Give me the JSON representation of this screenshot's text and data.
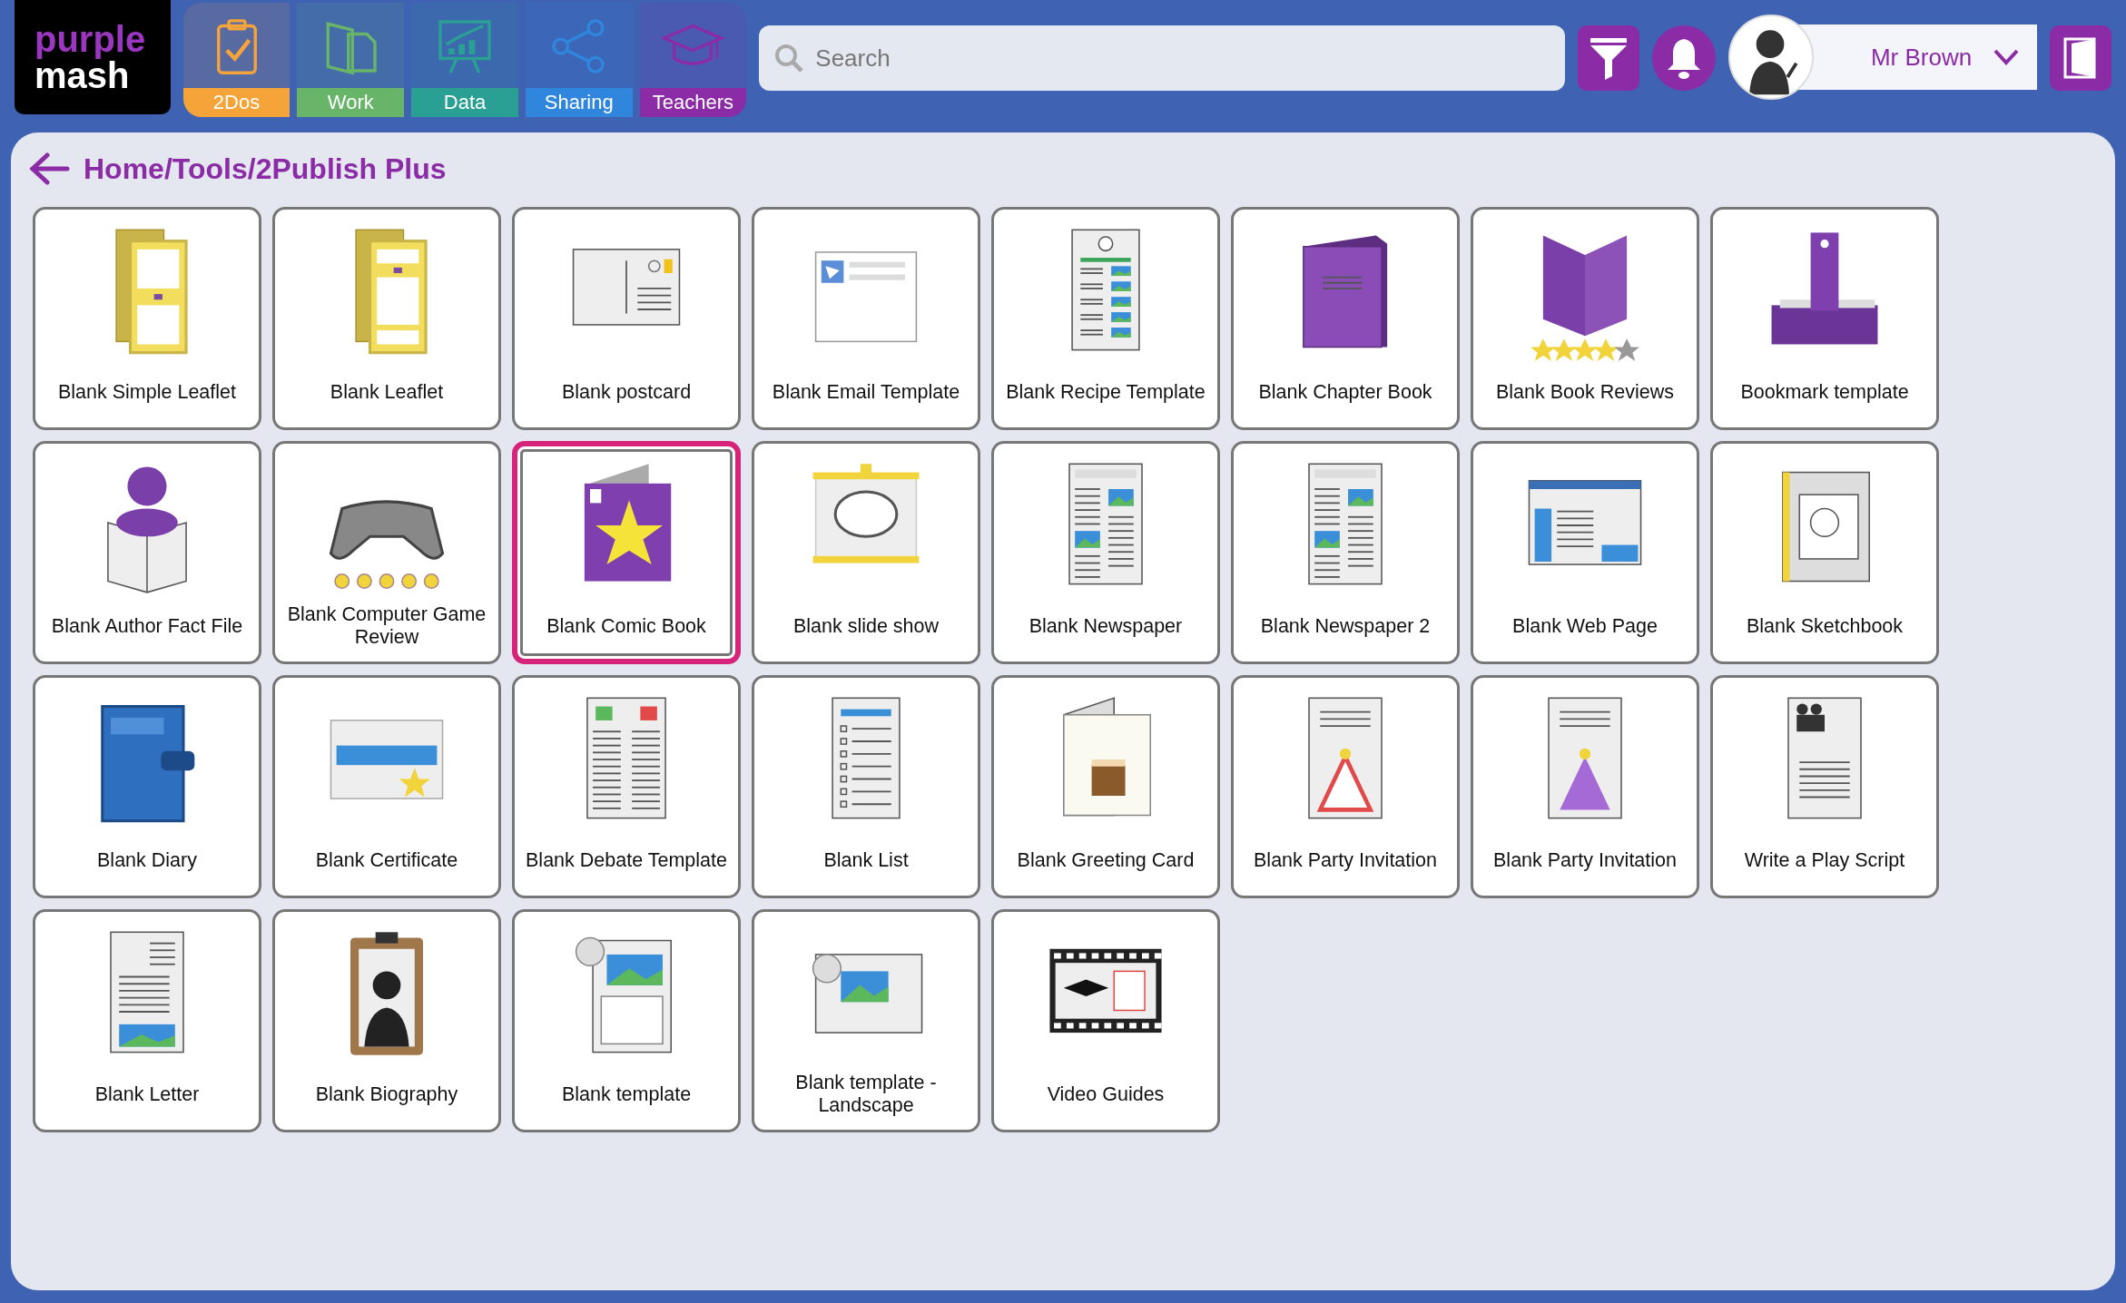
{
  "logo": {
    "line1": "purple",
    "line2": "mash"
  },
  "nav": [
    {
      "label": "2Dos",
      "kind": "todo",
      "color": "#f5a43a"
    },
    {
      "label": "Work",
      "kind": "work",
      "color": "#68b468"
    },
    {
      "label": "Data",
      "kind": "data",
      "color": "#2a9f94"
    },
    {
      "label": "Sharing",
      "kind": "sharing",
      "color": "#2f86dc"
    },
    {
      "label": "Teachers",
      "kind": "teachers",
      "color": "#8b2ba6"
    }
  ],
  "search": {
    "placeholder": "Search"
  },
  "user": {
    "name": "Mr Brown"
  },
  "breadcrumb": "Home/Tools/2Publish Plus",
  "tiles": [
    {
      "label": "Blank Simple Leaflet",
      "kind": "leaflet",
      "selected": false
    },
    {
      "label": "Blank Leaflet",
      "kind": "leaflet2",
      "selected": false
    },
    {
      "label": "Blank postcard",
      "kind": "postcard",
      "selected": false
    },
    {
      "label": "Blank Email Template",
      "kind": "email",
      "selected": false
    },
    {
      "label": "Blank Recipe Template",
      "kind": "recipe",
      "selected": false
    },
    {
      "label": "Blank Chapter Book",
      "kind": "book",
      "selected": false
    },
    {
      "label": "Blank Book Reviews",
      "kind": "reviews",
      "selected": false
    },
    {
      "label": "Bookmark template",
      "kind": "bookmark",
      "selected": false
    },
    {
      "label": "Blank Author Fact File",
      "kind": "author",
      "selected": false
    },
    {
      "label": "Blank Computer Game Review",
      "kind": "game",
      "selected": false
    },
    {
      "label": "Blank Comic Book",
      "kind": "comic",
      "selected": true
    },
    {
      "label": "Blank slide show",
      "kind": "slideshow",
      "selected": false
    },
    {
      "label": "Blank Newspaper",
      "kind": "newspaper",
      "selected": false
    },
    {
      "label": "Blank Newspaper 2",
      "kind": "newspaper",
      "selected": false
    },
    {
      "label": "Blank Web Page",
      "kind": "webpage",
      "selected": false
    },
    {
      "label": "Blank Sketchbook",
      "kind": "sketchbook",
      "selected": false
    },
    {
      "label": "Blank Diary",
      "kind": "diary",
      "selected": false
    },
    {
      "label": "Blank Certificate",
      "kind": "certificate",
      "selected": false
    },
    {
      "label": "Blank Debate Template",
      "kind": "debate",
      "selected": false
    },
    {
      "label": "Blank List",
      "kind": "list",
      "selected": false
    },
    {
      "label": "Blank Greeting Card",
      "kind": "greeting",
      "selected": false
    },
    {
      "label": "Blank Party Invitation",
      "kind": "party",
      "selected": false
    },
    {
      "label": "Blank Party Invitation",
      "kind": "party2",
      "selected": false
    },
    {
      "label": "Write a Play Script",
      "kind": "playscript",
      "selected": false
    },
    {
      "label": "Blank Letter",
      "kind": "letter",
      "selected": false
    },
    {
      "label": "Blank Biography",
      "kind": "biography",
      "selected": false
    },
    {
      "label": "Blank template",
      "kind": "template",
      "selected": false
    },
    {
      "label": "Blank template - Landscape",
      "kind": "landscape",
      "selected": false
    },
    {
      "label": "Video Guides",
      "kind": "video",
      "selected": false
    }
  ]
}
